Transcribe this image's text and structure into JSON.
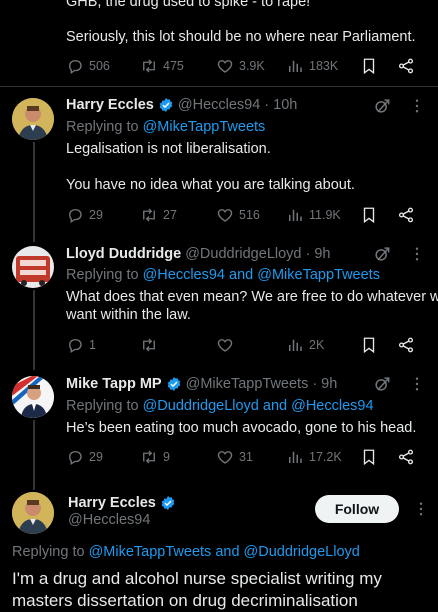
{
  "tweet0": {
    "text_line1": "GHB, the drug used to spike - to rape!",
    "text_line2": "Seriously, this lot should be no where near Parliament.",
    "replies": "506",
    "reposts": "475",
    "likes": "3.9K",
    "views": "183K"
  },
  "tweet1": {
    "name": "Harry Eccles",
    "handle": "@Heccles94",
    "time": "· 10h",
    "replying_prefix": "Replying to ",
    "replying_to": "@MikeTappTweets",
    "text_line1": "Legalisation is not liberalisation.",
    "text_line2": "You have no idea what you are talking about.",
    "replies": "29",
    "reposts": "27",
    "likes": "516",
    "views": "11.9K"
  },
  "tweet2": {
    "name": "Lloyd Duddridge",
    "handle": "@DuddridgeLloyd",
    "time": "· 9h",
    "replying_prefix": "Replying to ",
    "replying_to": "@Heccles94 and @MikeTappTweets",
    "text_line1": "What does that even mean? We are free to do whatever we",
    "text_line2": "want within the law.",
    "replies": "1",
    "reposts": "",
    "likes": "",
    "views": "2K"
  },
  "tweet3": {
    "name": "Mike Tapp MP",
    "handle": "@MikeTappTweets",
    "time": "· 9h",
    "replying_prefix": "Replying to ",
    "replying_to": "@DuddridgeLloyd and @Heccles94",
    "text_line1": "He’s been eating too much avocado, gone to his head.",
    "replies": "29",
    "reposts": "9",
    "likes": "31",
    "views": "17.2K"
  },
  "main_tweet": {
    "name": "Harry Eccles",
    "handle": "@Heccles94",
    "follow_label": "Follow",
    "replying_prefix": "Replying to ",
    "replying_to": "@MikeTappTweets and @DuddridgeLloyd",
    "text_line1": "I'm a drug and alcohol nurse specialist writing my",
    "text_line2": "masters dissertation on drug decriminalisation"
  },
  "icons": {
    "reply": "reply-icon",
    "repost": "repost-icon",
    "like": "heart-icon",
    "views": "views-icon",
    "bookmark": "bookmark-icon",
    "share": "share-icon",
    "grok": "grok-icon",
    "more": "more-icon",
    "verified": "verified-badge-icon"
  },
  "colors": {
    "background": "#000000",
    "link": "#1d9bf0",
    "verified": "#1d9bf0",
    "muted": "#71767b"
  }
}
